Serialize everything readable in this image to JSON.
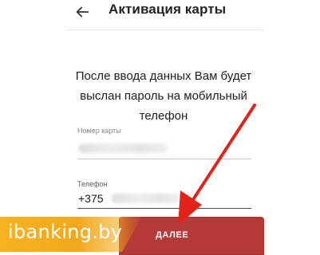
{
  "app": {
    "title": "Активация карты"
  },
  "info_text": "После ввода данных Вам будет\nвыслан пароль на мобильный\nтелефон",
  "card_field": {
    "label": "Номер карты"
  },
  "phone_field": {
    "label": "Телефон",
    "prefix": "+375"
  },
  "next_button": {
    "label": "ДАЛЕЕ"
  },
  "watermark": {
    "text": "ibanking.by"
  },
  "colors": {
    "button": "#b43a38",
    "arrow": "#e0241b",
    "watermark": "#f6b21d"
  },
  "icons": {
    "back": "arrow-left-icon"
  }
}
